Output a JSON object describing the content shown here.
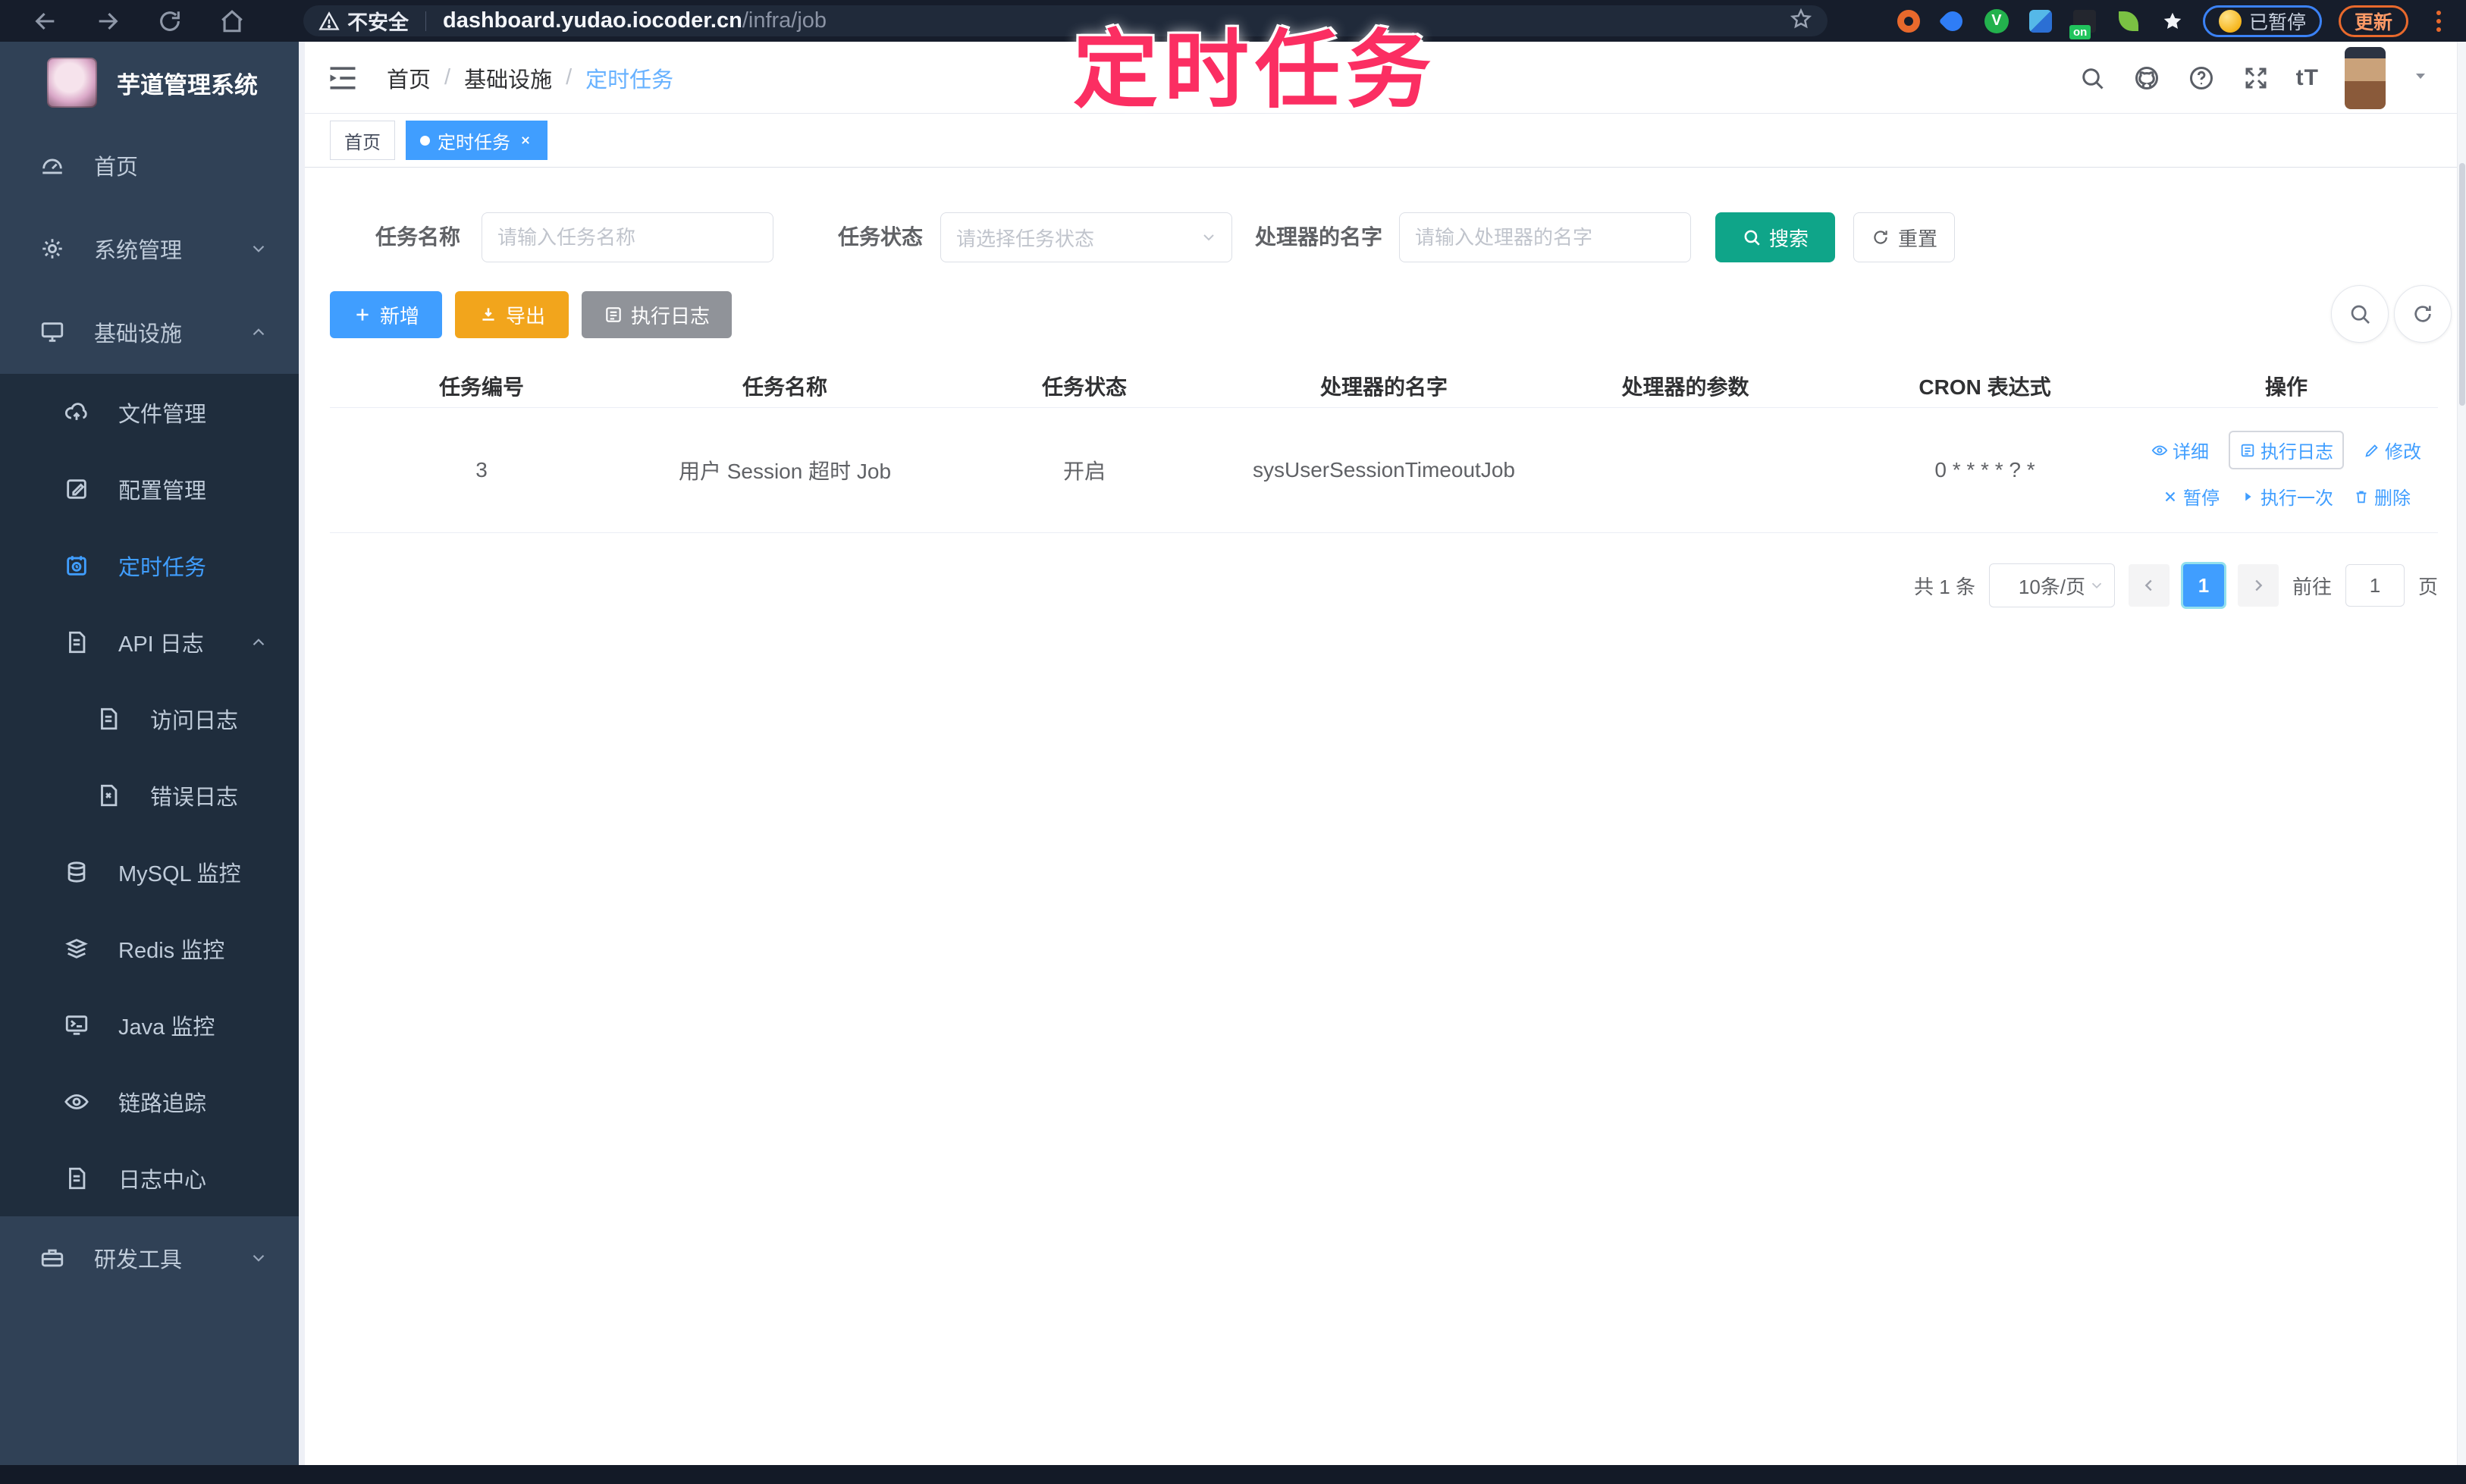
{
  "browser": {
    "security_label": "不安全",
    "url_host": "dashboard.yudao.iocoder.cn",
    "url_path": "/infra/job",
    "on_badge": "on",
    "paused_label": "已暂停",
    "update_label": "更新"
  },
  "watermark": "定时任务",
  "sidebar": {
    "title": "芋道管理系统",
    "items": [
      {
        "label": "首页"
      },
      {
        "label": "系统管理"
      },
      {
        "label": "基础设施"
      },
      {
        "label": "文件管理"
      },
      {
        "label": "配置管理"
      },
      {
        "label": "定时任务"
      },
      {
        "label": "API 日志"
      },
      {
        "label": "访问日志"
      },
      {
        "label": "错误日志"
      },
      {
        "label": "MySQL 监控"
      },
      {
        "label": "Redis 监控"
      },
      {
        "label": "Java 监控"
      },
      {
        "label": "链路追踪"
      },
      {
        "label": "日志中心"
      },
      {
        "label": "研发工具"
      }
    ]
  },
  "header": {
    "breadcrumb": [
      "首页",
      "基础设施",
      "定时任务"
    ],
    "separator": "/",
    "font_size_glyph": "tT"
  },
  "tabs": [
    {
      "label": "首页"
    },
    {
      "label": "定时任务"
    }
  ],
  "filters": {
    "name_label": "任务名称",
    "name_placeholder": "请输入任务名称",
    "status_label": "任务状态",
    "status_placeholder": "请选择任务状态",
    "handler_label": "处理器的名字",
    "handler_placeholder": "请输入处理器的名字",
    "search_label": "搜索",
    "reset_label": "重置"
  },
  "toolbar": {
    "add_label": "新增",
    "export_label": "导出",
    "log_label": "执行日志"
  },
  "table": {
    "columns": [
      "任务编号",
      "任务名称",
      "任务状态",
      "处理器的名字",
      "处理器的参数",
      "CRON 表达式",
      "操作"
    ],
    "rows": [
      {
        "id": "3",
        "name": "用户 Session 超时 Job",
        "status": "开启",
        "handler": "sysUserSessionTimeoutJob",
        "param": "",
        "cron": "0 * * * * ? *",
        "actions": [
          {
            "label": "详细"
          },
          {
            "label": "执行日志"
          },
          {
            "label": "修改"
          },
          {
            "label": "暂停"
          },
          {
            "label": "执行一次"
          },
          {
            "label": "删除"
          }
        ]
      }
    ]
  },
  "pagination": {
    "total_label": "共 1 条",
    "page_size_label": "10条/页",
    "current_page": "1",
    "goto_label": "前往",
    "page_unit": "页",
    "goto_value": "1"
  },
  "colors": {
    "accent": "#409EFF",
    "search_button": "#0FA589",
    "export_button": "#F2A51C",
    "log_button": "#909399",
    "watermark_pink": "#FB2E62",
    "sidebar_bg": "#304156",
    "submenu_bg": "#1F2D3D",
    "chrome_bg": "#161D2B"
  }
}
